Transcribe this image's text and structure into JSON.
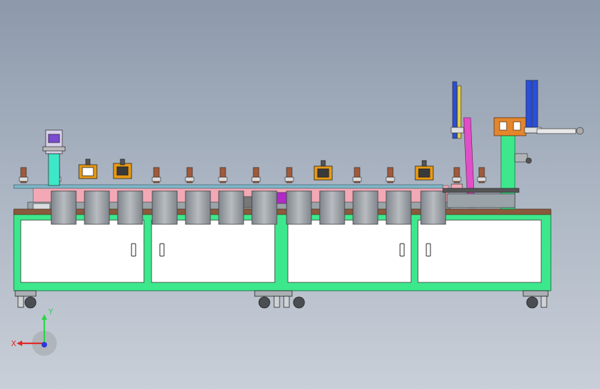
{
  "viewport": {
    "background_top": "#8d99ab",
    "background_bottom": "#c9cfd8"
  },
  "machine": {
    "frame_color": "#3de88c",
    "frame_edge_color": "#1a7a44",
    "panel_color": "#ffffff",
    "top_plate_color": "#8a5a3c",
    "rail_color": "#7fb8c8",
    "hopper_color": "#9ea3a8",
    "fixture_color": "#e89a14",
    "column_color": "#3de88c",
    "magenta_guide_color": "#e04fc8",
    "orange_block_color": "#e4862c",
    "pink_band_color": "#f2a9b5",
    "cylinder_blue_color": "#2a4fd8"
  },
  "triad": {
    "x_label": "X",
    "y_label": "Y",
    "x_color": "#e02a2a",
    "y_color": "#2ad44a",
    "z_color": "#2a3ad8"
  }
}
